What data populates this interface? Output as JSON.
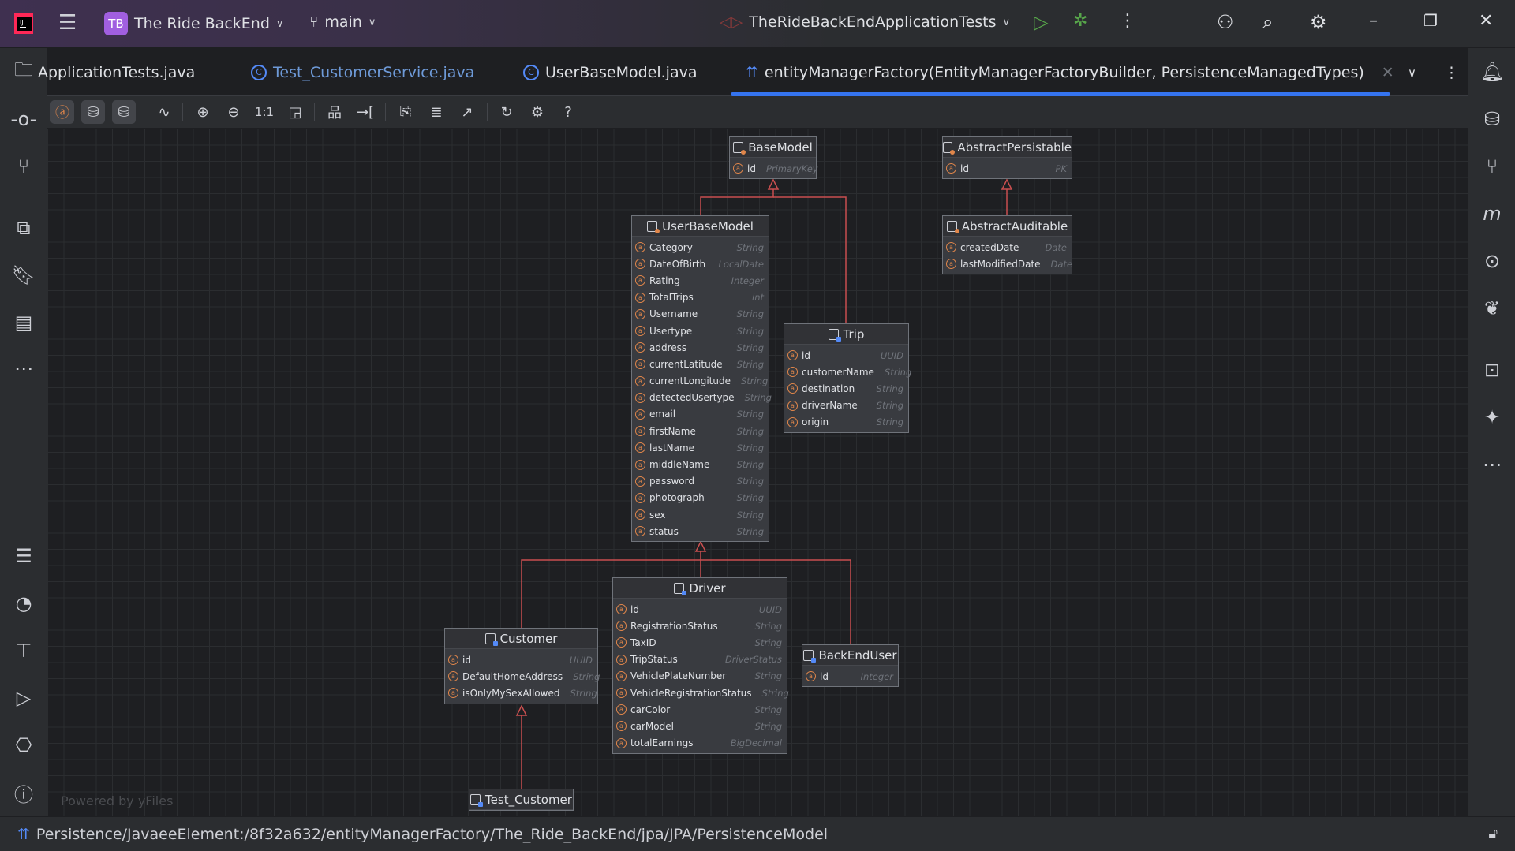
{
  "titlebar": {
    "project_badge": "TB",
    "project_name": "The Ride BackEnd",
    "branch": "main",
    "run_config": "TheRideBackEndApplicationTests"
  },
  "tabs": [
    {
      "label": "ApplicationTests.java",
      "icon": "class-icon"
    },
    {
      "label": "Test_CustomerService.java",
      "icon": "class-icon"
    },
    {
      "label": "UserBaseModel.java",
      "icon": "class-icon"
    },
    {
      "label": "entityManagerFactory(EntityManagerFactoryBuilder, PersistenceManagedTypes)",
      "icon": "persistence-icon",
      "active": true
    }
  ],
  "toolbar": {
    "actual_size_label": "1:1",
    "help_label": "?"
  },
  "diagram": {
    "watermark": "Powered by yFiles",
    "entities": [
      {
        "id": "BaseModel",
        "title": "BaseModel",
        "kind": "superclass",
        "fields": [
          {
            "name": "id",
            "type": "PrimaryKey",
            "pk": true
          }
        ]
      },
      {
        "id": "AbstractPersistable",
        "title": "AbstractPersistable",
        "kind": "superclass",
        "fields": [
          {
            "name": "id",
            "type": "PK",
            "pk": true
          }
        ]
      },
      {
        "id": "UserBaseModel",
        "title": "UserBaseModel",
        "kind": "superclass",
        "fields": [
          {
            "name": "Category",
            "type": "String"
          },
          {
            "name": "DateOfBirth",
            "type": "LocalDate"
          },
          {
            "name": "Rating",
            "type": "Integer"
          },
          {
            "name": "TotalTrips",
            "type": "int"
          },
          {
            "name": "Username",
            "type": "String"
          },
          {
            "name": "Usertype",
            "type": "String"
          },
          {
            "name": "address",
            "type": "String"
          },
          {
            "name": "currentLatitude",
            "type": "String"
          },
          {
            "name": "currentLongitude",
            "type": "String"
          },
          {
            "name": "detectedUsertype",
            "type": "String"
          },
          {
            "name": "email",
            "type": "String"
          },
          {
            "name": "firstName",
            "type": "String"
          },
          {
            "name": "lastName",
            "type": "String"
          },
          {
            "name": "middleName",
            "type": "String"
          },
          {
            "name": "password",
            "type": "String"
          },
          {
            "name": "photograph",
            "type": "String"
          },
          {
            "name": "sex",
            "type": "String"
          },
          {
            "name": "status",
            "type": "String"
          }
        ]
      },
      {
        "id": "AbstractAuditable",
        "title": "AbstractAuditable",
        "kind": "superclass",
        "fields": [
          {
            "name": "createdDate",
            "type": "Date"
          },
          {
            "name": "lastModifiedDate",
            "type": "Date"
          }
        ]
      },
      {
        "id": "Trip",
        "title": "Trip",
        "kind": "entity",
        "fields": [
          {
            "name": "id",
            "type": "UUID",
            "pk": true
          },
          {
            "name": "customerName",
            "type": "String"
          },
          {
            "name": "destination",
            "type": "String"
          },
          {
            "name": "driverName",
            "type": "String"
          },
          {
            "name": "origin",
            "type": "String"
          }
        ]
      },
      {
        "id": "Driver",
        "title": "Driver",
        "kind": "entity",
        "fields": [
          {
            "name": "id",
            "type": "UUID",
            "pk": true
          },
          {
            "name": "RegistrationStatus",
            "type": "String"
          },
          {
            "name": "TaxID",
            "type": "String"
          },
          {
            "name": "TripStatus",
            "type": "DriverStatus"
          },
          {
            "name": "VehiclePlateNumber",
            "type": "String"
          },
          {
            "name": "VehicleRegistrationStatus",
            "type": "String"
          },
          {
            "name": "carColor",
            "type": "String"
          },
          {
            "name": "carModel",
            "type": "String"
          },
          {
            "name": "totalEarnings",
            "type": "BigDecimal"
          }
        ]
      },
      {
        "id": "Customer",
        "title": "Customer",
        "kind": "entity",
        "fields": [
          {
            "name": "id",
            "type": "UUID",
            "pk": true
          },
          {
            "name": "DefaultHomeAddress",
            "type": "String"
          },
          {
            "name": "isOnlyMySexAllowed",
            "type": "String"
          }
        ]
      },
      {
        "id": "BackEndUser",
        "title": "BackEndUser",
        "kind": "entity",
        "fields": [
          {
            "name": "id",
            "type": "Integer",
            "pk": true
          }
        ]
      },
      {
        "id": "Test_Customer",
        "title": "Test_Customer",
        "kind": "entity",
        "fields": []
      }
    ],
    "inheritance": [
      {
        "child": "UserBaseModel",
        "parent": "BaseModel"
      },
      {
        "child": "Trip",
        "parent": "BaseModel"
      },
      {
        "child": "AbstractAuditable",
        "parent": "AbstractPersistable"
      },
      {
        "child": "Driver",
        "parent": "UserBaseModel"
      },
      {
        "child": "Customer",
        "parent": "UserBaseModel"
      },
      {
        "child": "BackEndUser",
        "parent": "UserBaseModel"
      },
      {
        "child": "Test_Customer",
        "parent": "Customer"
      }
    ],
    "edge_color": "#c94f4f"
  },
  "statusbar": {
    "path": "Persistence/JavaeeElement:/8f32a632/entityManagerFactory/The_Ride_BackEnd/jpa/JPA/PersistenceModel"
  }
}
